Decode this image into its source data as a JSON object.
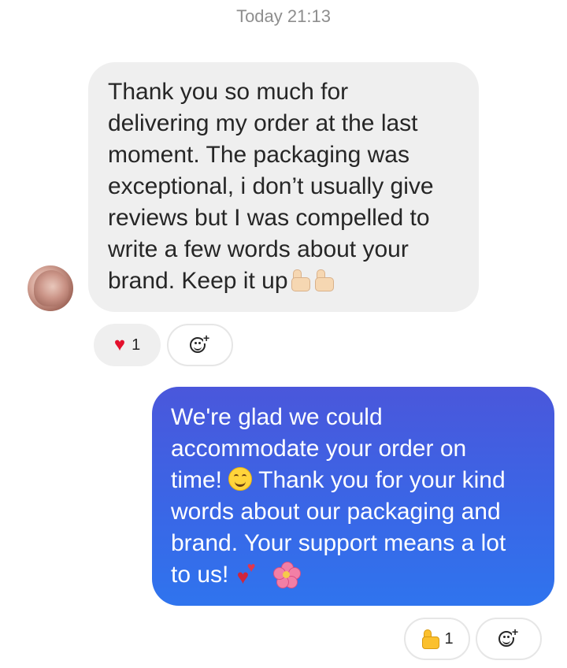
{
  "timestamp": "Today 21:13",
  "incoming": {
    "lines": [
      "Thank you so much for",
      "delivering my order at the last",
      "moment. The packaging was",
      "exceptional, i don’t usually give",
      "reviews but I was compelled to",
      "write a few words about your",
      "brand. Keep it up"
    ],
    "trailing_emojis": [
      "thumbs-up-light-skin",
      "thumbs-up-light-skin"
    ],
    "reaction": {
      "icon": "heart-icon",
      "count": "1"
    }
  },
  "outgoing": {
    "lines": [
      "We're glad we could",
      "accommodate your order on",
      "time!",
      "Thank you for your kind",
      "words about our packaging and",
      "brand. Your support means a lot",
      "to us!"
    ],
    "emojis": [
      "smiling-face",
      "two-hearts",
      "hibiscus"
    ],
    "reaction": {
      "icon": "thumbs-up-icon",
      "count": "1"
    }
  },
  "colors": {
    "incoming_bubble": "#efefef",
    "outgoing_gradient_top": "#4a57db",
    "outgoing_gradient_bottom": "#2f74ee",
    "heart": "#e3102c"
  }
}
